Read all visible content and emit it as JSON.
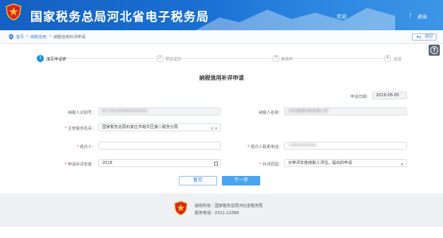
{
  "header": {
    "title": "国家税务总局河北省电子税务局",
    "user_label": "欢迎",
    "separator": "|",
    "logout": "退出"
  },
  "breadcrumb": {
    "home": "首页",
    "section": "纳税信用",
    "current": "纳税信用补评申请",
    "back": "返回"
  },
  "steps": [
    {
      "number": "1",
      "label": "填写申请表",
      "active": true
    },
    {
      "number": "2",
      "label": "预览提交",
      "active": false
    },
    {
      "number": "3",
      "label": "审核中",
      "active": false
    },
    {
      "number": "4",
      "label": "完成",
      "active": false
    }
  ],
  "form": {
    "title": "纳税信用补评申请",
    "apply_date_label": "申请日期：",
    "apply_date": "2019-06-05",
    "taxpayer_id_label": "纳税人识别号：",
    "taxpayer_id": "91130100MA0XXXXXX",
    "taxpayer_name_label": "纳税人名称：",
    "taxpayer_name": "河北某某科技有限公司",
    "tax_authority_label": "主管税务机关：",
    "tax_authority": "国家税务总局石家庄市裕华区第二税务分局",
    "agent_label": "经办人：",
    "agent_value": "",
    "agent_phone_label": "经办人联系电话：",
    "agent_phone": "13800000000",
    "year_label": "申请补评年度：",
    "year_value": "2018",
    "reason_label": "补评原因：",
    "reason_value": "对参评年度纳税人评估，提出的申请"
  },
  "buttons": {
    "save": "暂存",
    "next": "下一步"
  },
  "footer": {
    "copyright": "版权所有：国家税务总局河北省税务局",
    "phone": "服务电话：0311-12366"
  },
  "colors": {
    "header_blue": "#1a6fd3",
    "accent": "#1a8fe0",
    "required": "#e33333"
  }
}
